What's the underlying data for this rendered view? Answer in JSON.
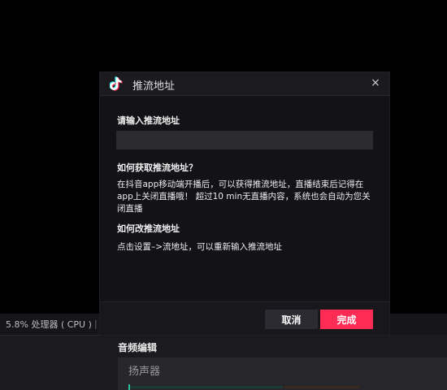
{
  "background": {
    "status_text": "5.8% 处理器 ( CPU )",
    "status_separator": "|",
    "audio_section_title": "音频编辑",
    "mixer_channel_label": "扬声器"
  },
  "dialog": {
    "title": "推流地址",
    "close_glyph": "×",
    "input_label": "请输入推流地址",
    "input_value": "",
    "input_placeholder": "",
    "help_heading_1": "如何获取推流地址？",
    "help_text_1": "在抖音app移动端开播后，可以获得推流地址，直播结束后记得在app上关闭直播哦！ 超过10 min无直播内容，系统也会自动为您关闭直播",
    "help_heading_2": "如何改推流地址",
    "help_text_2": "点击设置–>流地址，可以重新输入推流地址",
    "cancel_label": "取消",
    "done_label": "完成"
  },
  "colors": {
    "accent": "#fe2c55",
    "dialog_bg": "#131317",
    "input_bg": "#2b2b30",
    "cancel_bg": "#2b2b31",
    "meter_green": "#2fbf9a"
  },
  "icons": {
    "app_icon": "tiktok-logo-icon",
    "close_icon": "close-icon"
  }
}
